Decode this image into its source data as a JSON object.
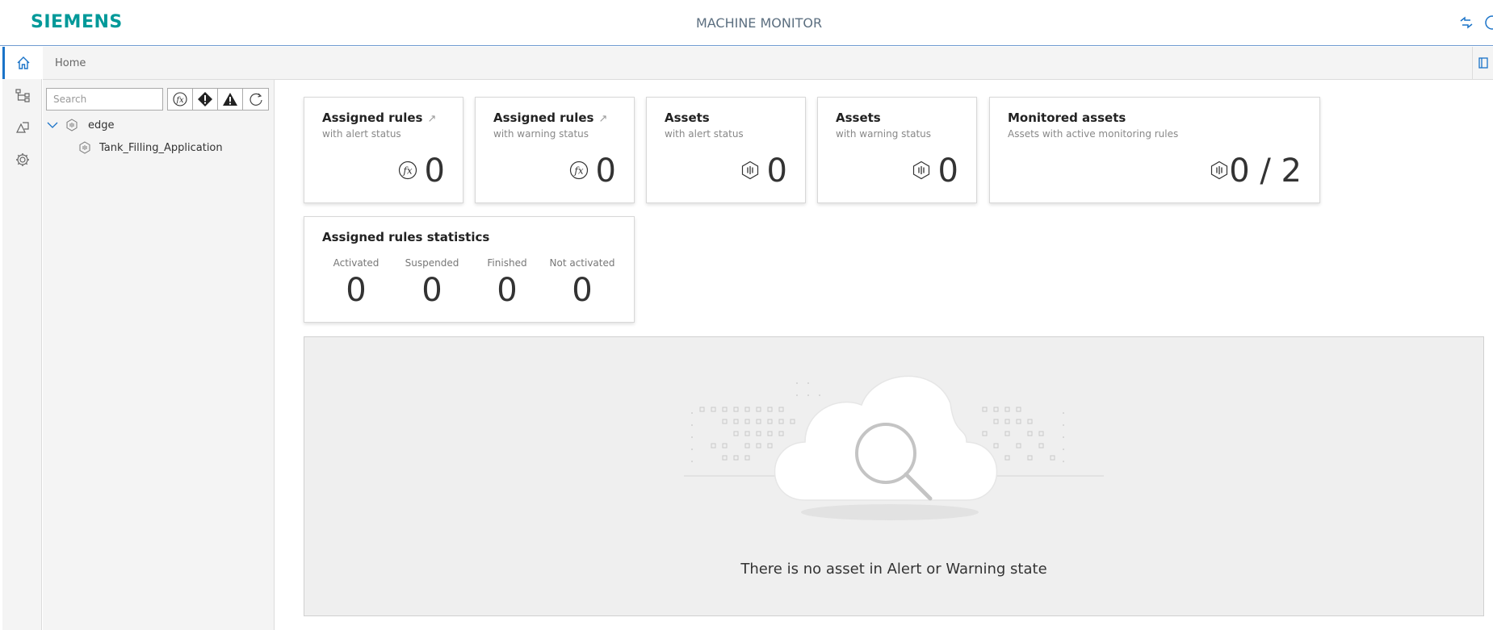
{
  "header": {
    "brand": "SIEMENS",
    "title": "MACHINE MONITOR"
  },
  "breadcrumb": {
    "current": "Home"
  },
  "tree": {
    "search_placeholder": "Search",
    "filters": [
      "rule-filter-icon",
      "alert-filter-icon",
      "warning-filter-icon",
      "refresh-icon"
    ],
    "nodes": [
      {
        "label": "edge",
        "level": 0,
        "expanded": true
      },
      {
        "label": "Tank_Filling_Application",
        "level": 1
      }
    ]
  },
  "cards": [
    {
      "title": "Assigned rules",
      "subtitle": "with alert status",
      "value": "0",
      "icon": "rule-icon",
      "has_link": true
    },
    {
      "title": "Assigned rules",
      "subtitle": "with warning status",
      "value": "0",
      "icon": "rule-icon",
      "has_link": true
    },
    {
      "title": "Assets",
      "subtitle": "with alert status",
      "value": "0",
      "icon": "asset-icon"
    },
    {
      "title": "Assets",
      "subtitle": "with warning status",
      "value": "0",
      "icon": "asset-icon"
    },
    {
      "title": "Monitored assets",
      "subtitle": "Assets with active monitoring rules",
      "value": "0 / 2",
      "icon": "asset-icon"
    }
  ],
  "stats": {
    "title": "Assigned rules statistics",
    "items": [
      {
        "label": "Activated",
        "value": "0"
      },
      {
        "label": "Suspended",
        "value": "0"
      },
      {
        "label": "Finished",
        "value": "0"
      },
      {
        "label": "Not activated",
        "value": "0"
      }
    ]
  },
  "empty_state": {
    "message": "There is no asset in Alert or Warning state"
  },
  "colors": {
    "brand": "#009999",
    "accent": "#1a73c8",
    "panel": "#f4f4f4"
  }
}
